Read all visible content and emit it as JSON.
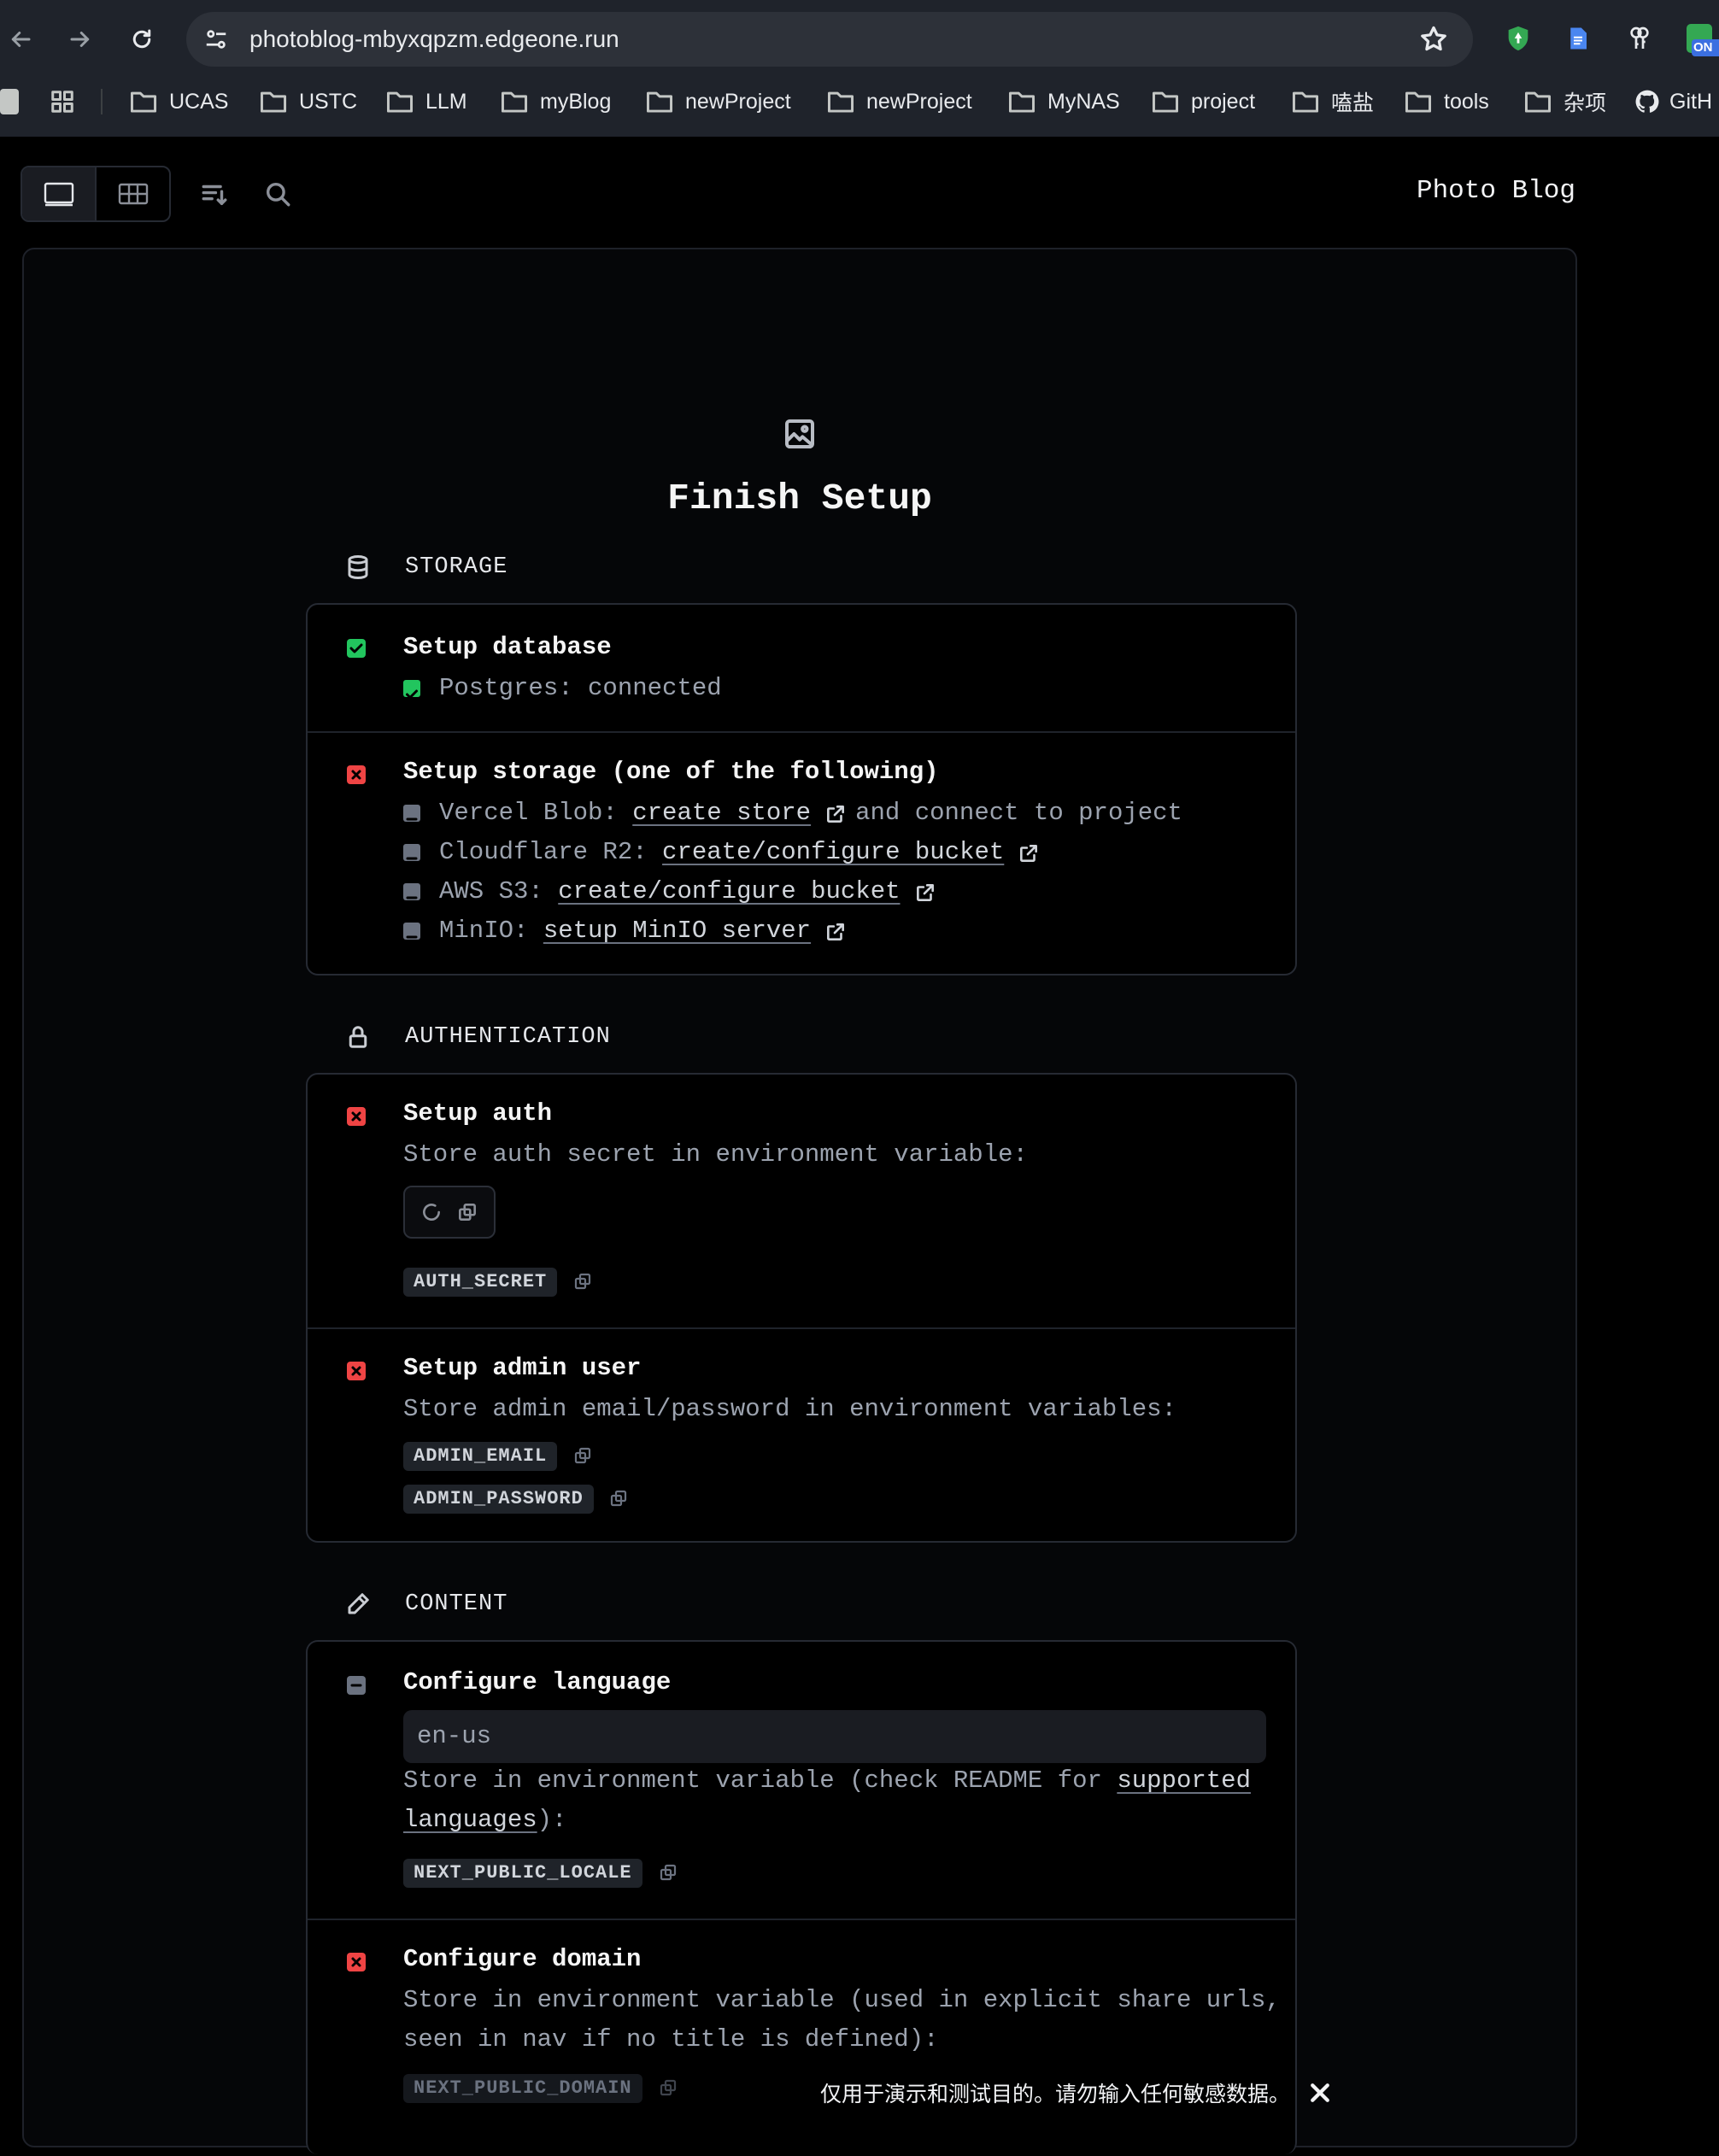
{
  "browser": {
    "url": "photoblog-mbyxqpzm.edgeone.run",
    "bookmarks": [
      "UCAS",
      "USTC",
      "LLM",
      "myBlog",
      "newProject",
      "newProject",
      "MyNAS",
      "project",
      "嗑盐",
      "tools",
      "杂项",
      "GitH"
    ],
    "ext_badge": "ON"
  },
  "app": {
    "site_title": "Photo Blog",
    "page_title": "Finish Setup"
  },
  "sections": {
    "storage": {
      "title": "STORAGE",
      "database": {
        "title": "Setup database",
        "status": "Postgres: connected"
      },
      "storage": {
        "title": "Setup storage (one of the following)",
        "options": [
          {
            "name": "Vercel Blob: ",
            "link": "create store",
            "suffix": "and connect to project"
          },
          {
            "name": "Cloudflare R2: ",
            "link": "create/configure bucket",
            "suffix": ""
          },
          {
            "name": "AWS S3: ",
            "link": "create/configure bucket",
            "suffix": ""
          },
          {
            "name": "MinIO: ",
            "link": "setup MinIO server",
            "suffix": ""
          }
        ]
      }
    },
    "auth": {
      "title": "AUTHENTICATION",
      "setup_auth": {
        "title": "Setup auth",
        "desc": "Store auth secret in environment variable:",
        "var": "AUTH_SECRET"
      },
      "admin": {
        "title": "Setup admin user",
        "desc": "Store admin email/password in environment variables:",
        "var_email": "ADMIN_EMAIL",
        "var_password": "ADMIN_PASSWORD"
      }
    },
    "content": {
      "title": "CONTENT",
      "language": {
        "title": "Configure language",
        "value": "en-us",
        "desc_pre": "Store in environment variable (check README for ",
        "desc_link_1": "supported",
        "desc_link_2": "languages",
        "desc_post": "):",
        "var": "NEXT_PUBLIC_LOCALE"
      },
      "domain": {
        "title": "Configure domain",
        "desc_1": "Store in environment variable (used in explicit share urls,",
        "desc_2": "seen in nav if no title is defined):",
        "var": "NEXT_PUBLIC_DOMAIN"
      }
    }
  },
  "toast": {
    "text": "仅用于演示和测试目的。请勿输入任何敏感数据。"
  },
  "colors": {
    "ok": "#22c55e",
    "error": "#ef4444",
    "optional": "#6b7280",
    "chrome_bg": "#1f232b"
  }
}
